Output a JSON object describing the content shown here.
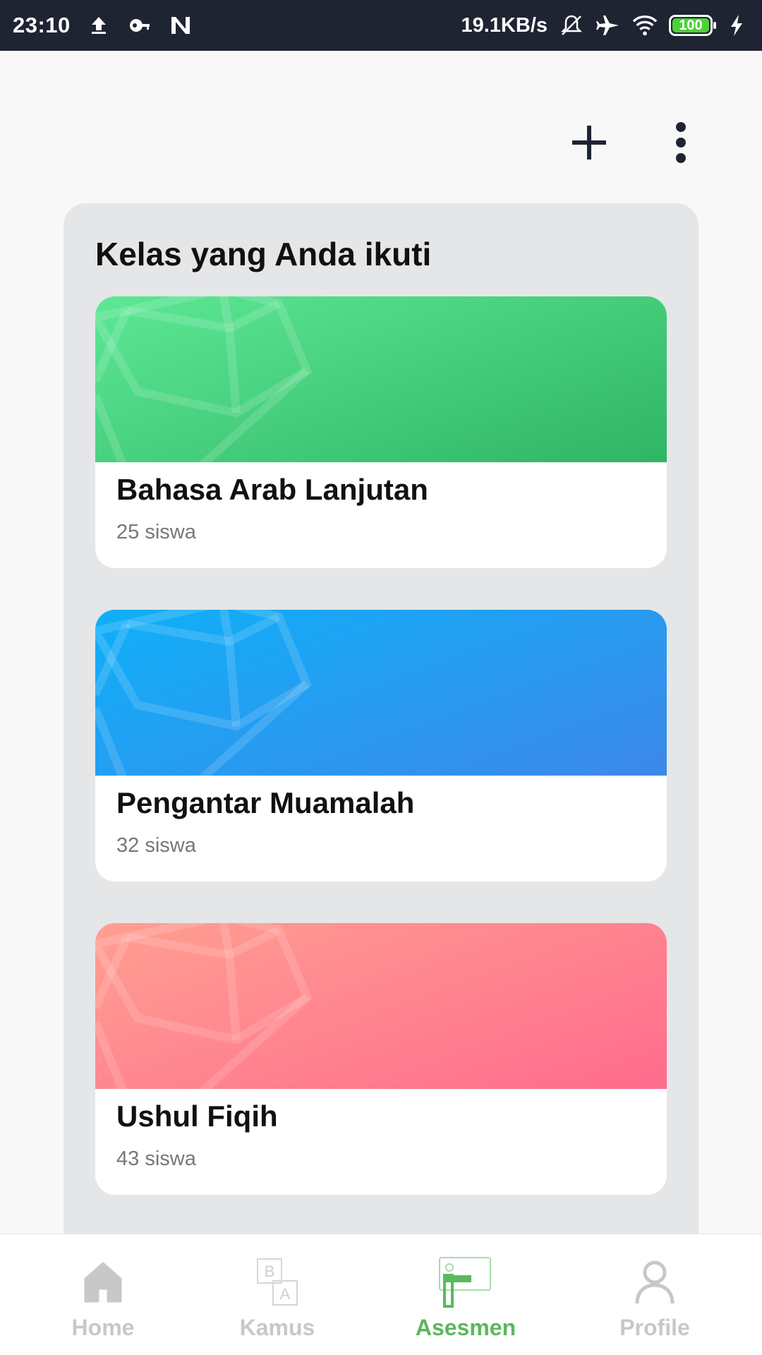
{
  "status_bar": {
    "time": "23:10",
    "network_speed": "19.1KB/s",
    "battery_level": "100",
    "icons": [
      "upload-icon",
      "vpn-key-icon",
      "n-app-icon",
      "mute-vibrate-icon",
      "airplane-icon",
      "wifi-icon",
      "battery-icon",
      "charging-icon"
    ]
  },
  "toolbar": {
    "add_icon": "plus-icon",
    "more_icon": "more-vertical-icon"
  },
  "section": {
    "title": "Kelas yang Anda ikuti"
  },
  "classes": [
    {
      "name": "Bahasa Arab Lanjutan",
      "students": "25 siswa",
      "gradient": [
        "#5de895",
        "#2fb563"
      ]
    },
    {
      "name": "Pengantar Muamalah",
      "students": "32 siswa",
      "gradient": [
        "#0fb0f8",
        "#3d88ea"
      ]
    },
    {
      "name": "Ushul Fiqih",
      "students": "43 siswa",
      "gradient": [
        "#ff9f91",
        "#ff6b8d"
      ]
    }
  ],
  "bottom_nav": {
    "items": [
      {
        "label": "Home",
        "icon": "home-icon",
        "active": false
      },
      {
        "label": "Kamus",
        "icon": "dictionary-icon",
        "active": false
      },
      {
        "label": "Asesmen",
        "icon": "assessment-icon",
        "active": true
      },
      {
        "label": "Profile",
        "icon": "profile-icon",
        "active": false
      }
    ],
    "active_color": "#5cb85c",
    "inactive_color": "#c8c8c8"
  }
}
